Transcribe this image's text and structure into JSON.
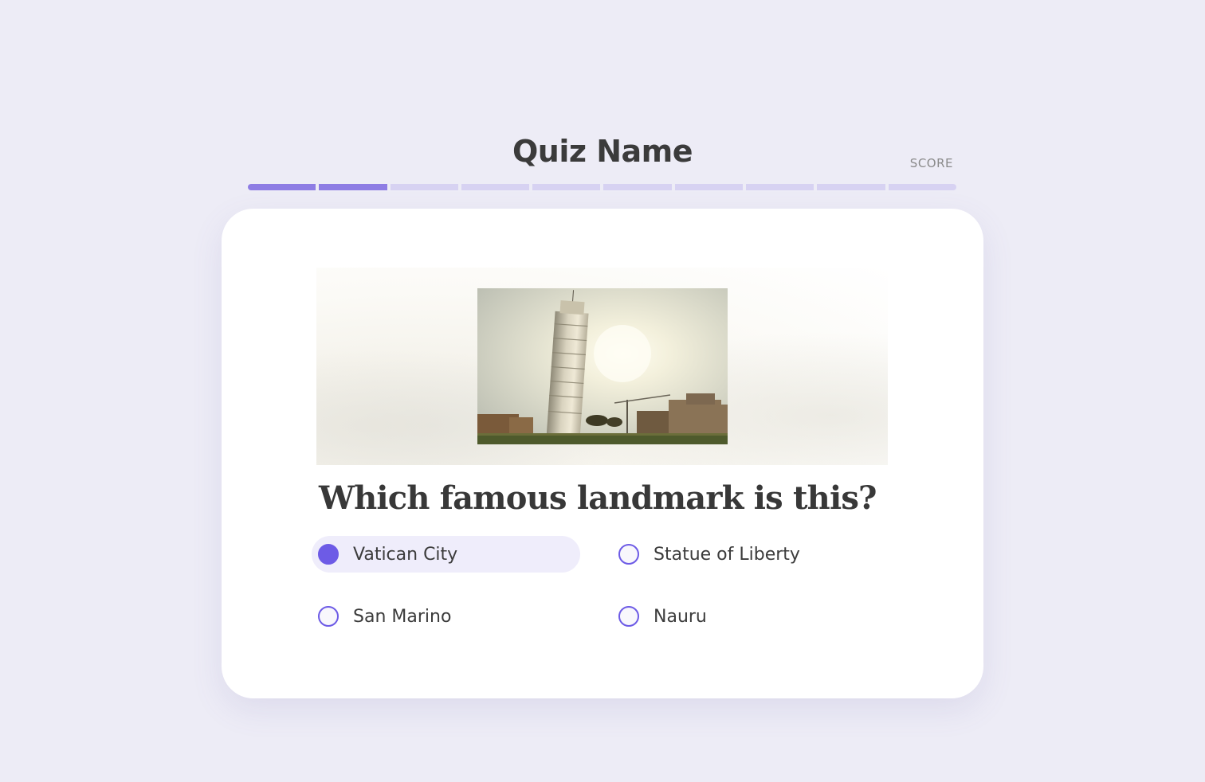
{
  "header": {
    "quiz_title": "Quiz Name",
    "score_label": "SCORE"
  },
  "progress": {
    "total_steps": 10,
    "completed_steps": 2
  },
  "question": {
    "text": "Which famous landmark is this?",
    "image_icon": "leaning-tower-photo"
  },
  "options": [
    {
      "label": "Vatican City",
      "selected": true
    },
    {
      "label": "Statue of Liberty",
      "selected": false
    },
    {
      "label": "San Marino",
      "selected": false
    },
    {
      "label": "Nauru",
      "selected": false
    }
  ],
  "colors": {
    "accent": "#6d5be6",
    "progress_done": "#8e7de4",
    "progress_todo": "#d7d2f2",
    "background": "#edecf6",
    "selected_bg": "#efedfb"
  }
}
